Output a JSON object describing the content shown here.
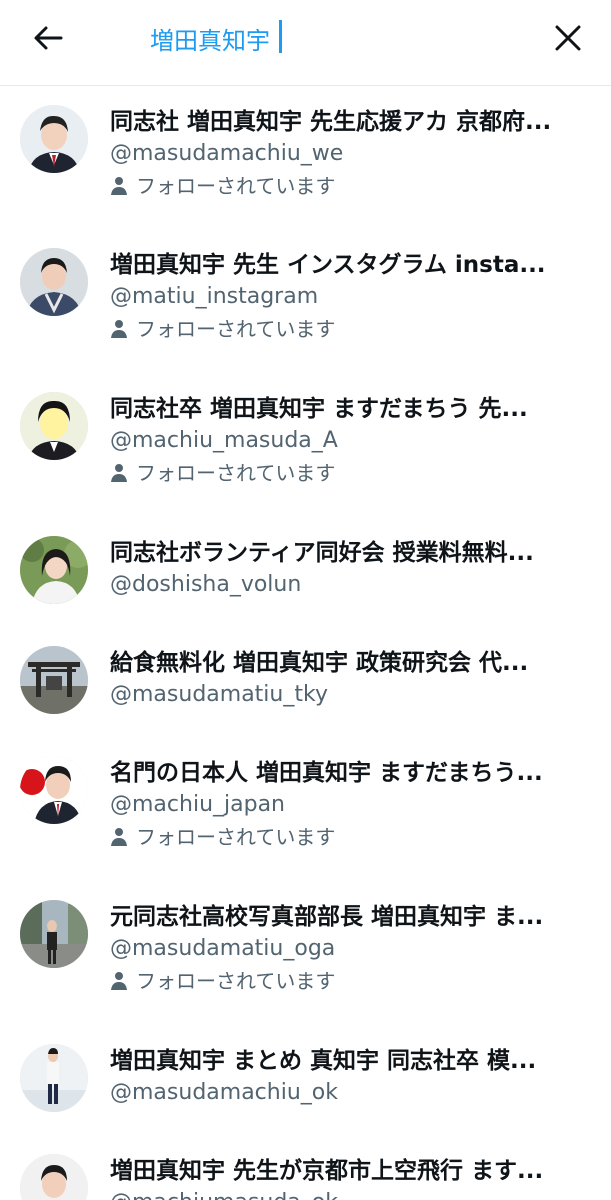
{
  "search": {
    "value": "増田真知宇",
    "back_icon": "arrow-left-icon",
    "clear_icon": "close-icon"
  },
  "results": [
    {
      "name": "同志社 増田真知宇 先生応援アカ 京都府...",
      "handle": "@masudamachiu_we",
      "follows_you": "フォローされています",
      "avatar": "man-suit-red-tie"
    },
    {
      "name": "増田真知宇 先生 インスタグラム insta...",
      "handle": "@matiu_instagram",
      "follows_you": "フォローされています",
      "avatar": "man-kimono"
    },
    {
      "name": "同志社卒 増田真知宇 ますだまちう 先...",
      "handle": "@machiu_masuda_A",
      "follows_you": "フォローされています",
      "avatar": "man-bright-face"
    },
    {
      "name": "同志社ボランティア同好会 授業料無料...",
      "handle": "@doshisha_volun",
      "follows_you": "",
      "avatar": "woman-outdoors"
    },
    {
      "name": "給食無料化 増田真知宇 政策研究会 代...",
      "handle": "@masudamatiu_tky",
      "follows_you": "",
      "avatar": "shrine-gate"
    },
    {
      "name": "名門の日本人 増田真知宇 ますだまちう...",
      "handle": "@machiu_japan",
      "follows_you": "フォローされています",
      "avatar": "man-japan-flag"
    },
    {
      "name": "元同志社高校写真部部長 増田真知宇 ま...",
      "handle": "@masudamatiu_oga",
      "follows_you": "フォローされています",
      "avatar": "street-photo"
    },
    {
      "name": "増田真知宇 まとめ 真知宇 同志社卒 模...",
      "handle": "@masudamachiu_ok",
      "follows_you": "",
      "avatar": "man-full-body"
    },
    {
      "name": "増田真知宇 先生が京都市上空飛行 ます...",
      "handle": "@machiumasuda_ok",
      "follows_you": "",
      "avatar": "man-suit"
    }
  ],
  "colors": {
    "accent": "#1d9bf0",
    "text_primary": "#0f1419",
    "text_secondary": "#536471"
  }
}
